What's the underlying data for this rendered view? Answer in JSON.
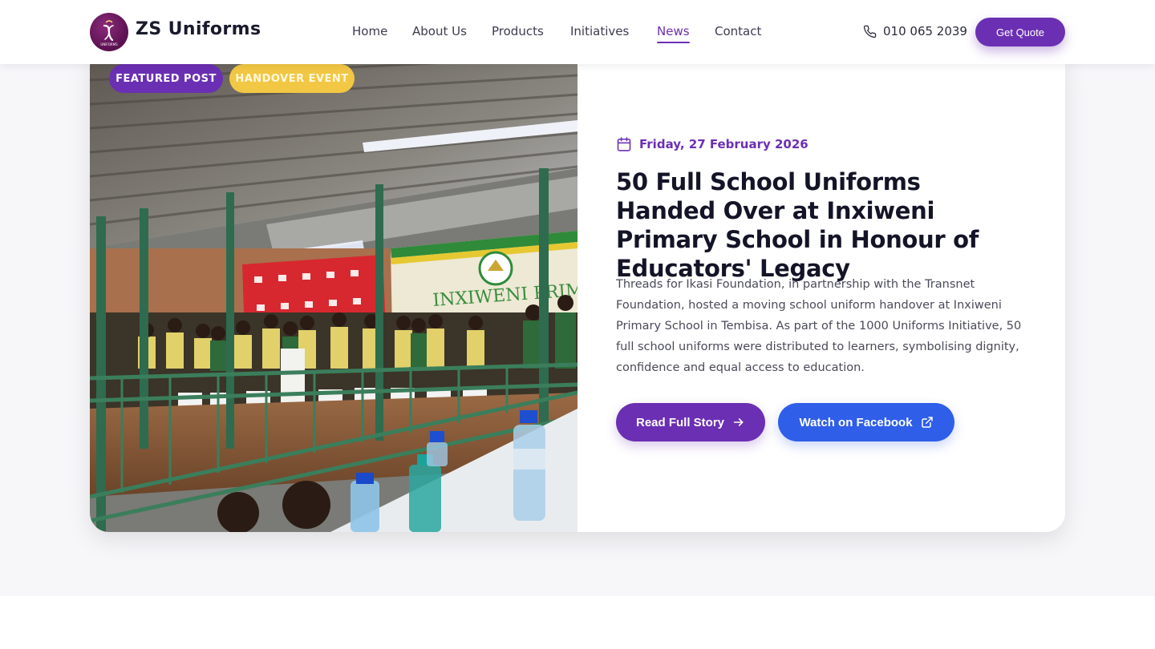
{
  "header": {
    "brand": "ZS Uniforms",
    "logo_text": "UNIFORMS",
    "nav": [
      {
        "label": "Home"
      },
      {
        "label": "About Us"
      },
      {
        "label": "Products"
      },
      {
        "label": "Initiatives"
      },
      {
        "label": "News",
        "active": true
      },
      {
        "label": "Contact"
      }
    ],
    "phone": "010 065 2039",
    "quote_label": "Get Quote"
  },
  "featured": {
    "badges": [
      "FEATURED POST",
      "HANDOVER EVENT"
    ],
    "date": "Friday, 27 February 2026",
    "title": "50 Full School Uniforms Handed Over at Inxiweni Primary School in Honour of Educators' Legacy",
    "description": "Threads for Ikasi Foundation, in partnership with the Transnet Foundation, hosted a moving school uniform handover at Inxiweni Primary School in Tembisa. As part of the 1000 Uniforms Initiative, 50 full school uniforms were distributed to learners, symbolising dignity, confidence and equal access to education.",
    "read_label": "Read Full Story",
    "facebook_label": "Watch on Facebook",
    "photo_sign_text": "INXIWENI PRIMARY SCHOOL"
  },
  "colors": {
    "primary": "#6b2fb3",
    "facebook": "#2f5ee8",
    "badge_yellow": "#f2c744",
    "page_bg": "#f7f7fa"
  },
  "icons": {
    "phone": "phone-icon",
    "calendar": "calendar-icon",
    "arrow": "arrow-right-icon",
    "external": "external-link-icon"
  }
}
